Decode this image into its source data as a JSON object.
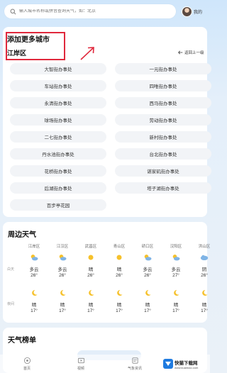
{
  "search": {
    "placeholder": "输入城市名称或拼音查询天气，如：北京"
  },
  "header": {
    "my_label": "我的"
  },
  "add_city": {
    "title": "添加更多城市",
    "district": "江岸区",
    "back_label": "返回上一级",
    "streets": [
      "大智街办事处",
      "一元街办事处",
      "车站街办事处",
      "四唯街办事处",
      "永清街办事处",
      "西马街办事处",
      "球场街办事处",
      "劳动街办事处",
      "二七街办事处",
      "新村街办事处",
      "丹水池街办事处",
      "台北街办事处",
      "花桥街办事处",
      "谌家矶街办事处",
      "后湖街办事处",
      "塔子湖街办事处",
      "百步亭花园"
    ]
  },
  "around": {
    "title": "周边天气",
    "row_labels": {
      "day": "白天",
      "night": "夜间"
    },
    "cities": [
      {
        "name": "江岸区",
        "day_icon": "partly-cloudy-icon",
        "day_cond": "多云",
        "day_temp": "26°",
        "night_icon": "moon-icon",
        "night_cond": "晴",
        "night_temp": "17°"
      },
      {
        "name": "江汉区",
        "day_icon": "partly-cloudy-icon",
        "day_cond": "多云",
        "day_temp": "26°",
        "night_icon": "moon-icon",
        "night_cond": "晴",
        "night_temp": "17°"
      },
      {
        "name": "武昌区",
        "day_icon": "sun-icon",
        "day_cond": "晴",
        "day_temp": "26°",
        "night_icon": "moon-icon",
        "night_cond": "晴",
        "night_temp": "17°"
      },
      {
        "name": "青山区",
        "day_icon": "sun-icon",
        "day_cond": "晴",
        "day_temp": "26°",
        "night_icon": "moon-icon",
        "night_cond": "晴",
        "night_temp": "17°"
      },
      {
        "name": "硚口区",
        "day_icon": "partly-cloudy-icon",
        "day_cond": "多云",
        "day_temp": "26°",
        "night_icon": "moon-icon",
        "night_cond": "晴",
        "night_temp": "17°"
      },
      {
        "name": "汉阳区",
        "day_icon": "partly-cloudy-icon",
        "day_cond": "多云",
        "day_temp": "27°",
        "night_icon": "moon-icon",
        "night_cond": "晴",
        "night_temp": "17°"
      },
      {
        "name": "洪山区",
        "day_icon": "cloudy-icon",
        "day_cond": "阴",
        "day_temp": "26°",
        "night_icon": "moon-icon",
        "night_cond": "晴",
        "night_temp": "17°"
      }
    ]
  },
  "ranking": {
    "title": "天气榜单"
  },
  "bottom_nav": [
    {
      "label": "首页",
      "icon": "home-icon"
    },
    {
      "label": "视频",
      "icon": "video-icon"
    },
    {
      "label": "气象资讯",
      "icon": "news-icon"
    }
  ],
  "watermark": {
    "line1": "快猫下载网",
    "line2": "www.kuaimao.com"
  },
  "colors": {
    "highlight": "#e0283c",
    "sun": "#f6c12b",
    "cloud": "#7fb4e6"
  }
}
